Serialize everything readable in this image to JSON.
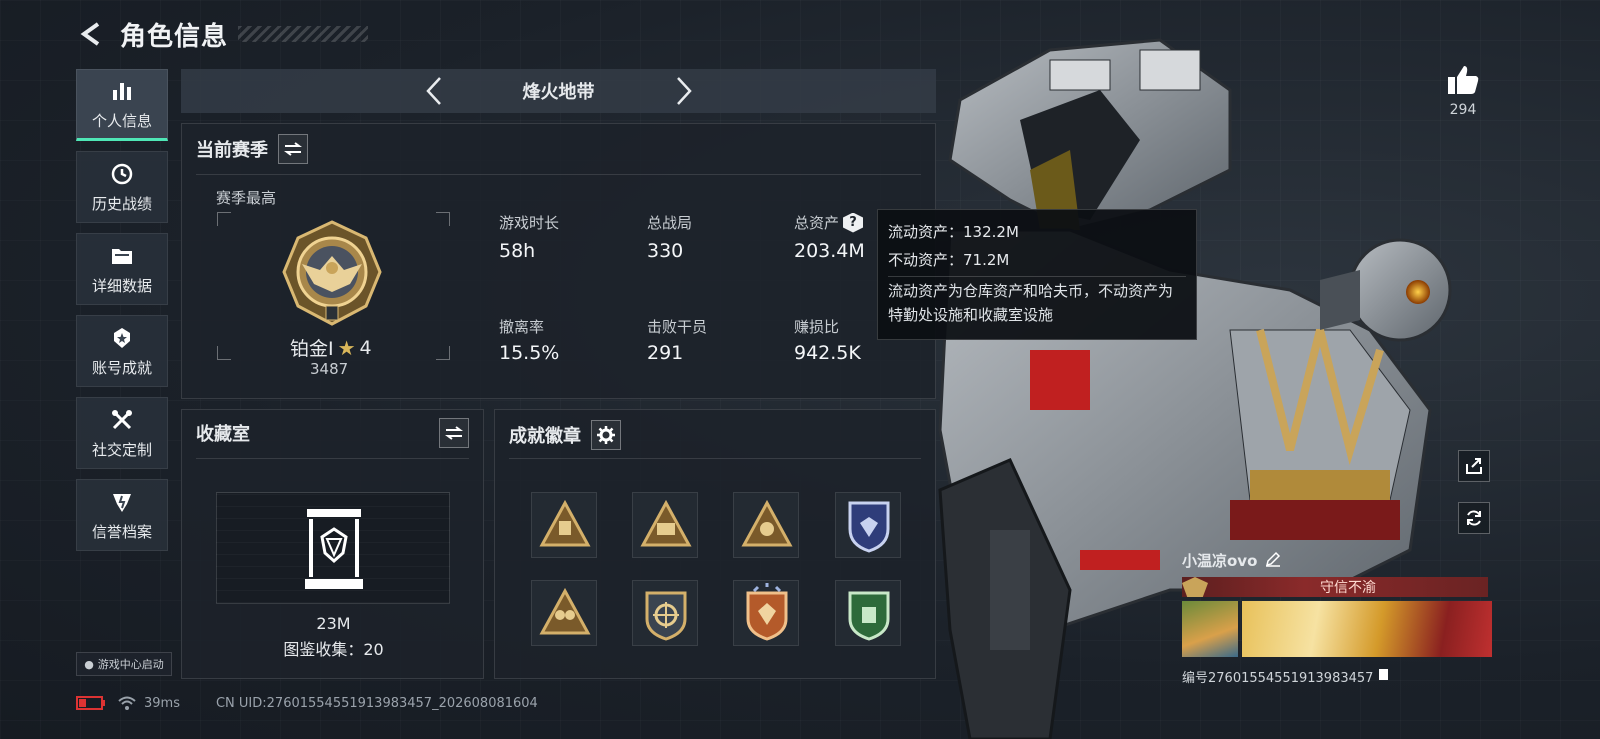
{
  "header": {
    "title": "角色信息"
  },
  "sidebar": {
    "items": [
      {
        "label": "个人信息",
        "icon": "bar-chart-icon",
        "active": true
      },
      {
        "label": "历史战绩",
        "icon": "clock-icon"
      },
      {
        "label": "详细数据",
        "icon": "folder-icon"
      },
      {
        "label": "账号成就",
        "icon": "achievement-icon"
      },
      {
        "label": "社交定制",
        "icon": "tools-icon"
      },
      {
        "label": "信誉档案",
        "icon": "credit-icon"
      }
    ],
    "launch_label": "游戏中心启动"
  },
  "mode": {
    "title": "烽火地带"
  },
  "season": {
    "title": "当前赛季",
    "best_label": "赛季最高",
    "rank": "铂金Ⅰ",
    "stars": "4",
    "score": "3487",
    "stats": [
      {
        "label": "游戏时长",
        "value": "58h"
      },
      {
        "label": "总战局",
        "value": "330"
      },
      {
        "label": "总资产",
        "value": "203.4M"
      },
      {
        "label": "撤离率",
        "value": "15.5%"
      },
      {
        "label": "击败干员",
        "value": "291"
      },
      {
        "label": "赚损比",
        "value": "942.5K"
      }
    ]
  },
  "tooltip": {
    "liquid": "流动资产：132.2M",
    "fixed": "不动资产：71.2M",
    "desc": "流动资产为仓库资产和哈夫币，不动资产为特勤处设施和收藏室设施"
  },
  "collection": {
    "title": "收藏室",
    "value": "23M",
    "count_label": "图鉴收集：20"
  },
  "badges": {
    "title": "成就徽章"
  },
  "likes": {
    "count": "294"
  },
  "player": {
    "name": "小温凉ovo",
    "honor": "守信不渝",
    "serial": "编号27601554551913983457"
  },
  "footer": {
    "ping": "39ms",
    "uid": "CN UID:27601554551913983457_202608081604"
  },
  "colors": {
    "accent": "#4fe7b6",
    "gold": "#c9a45a",
    "honor": "#8a2a2a"
  }
}
